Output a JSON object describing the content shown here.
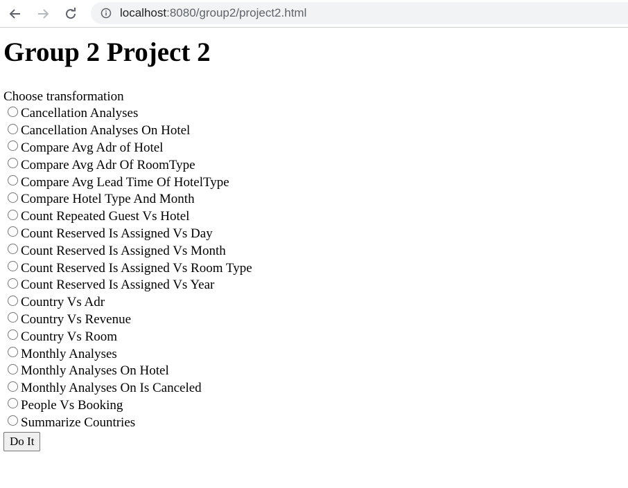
{
  "browser": {
    "url_host": "localhost",
    "url_rest": ":8080/group2/project2.html"
  },
  "page": {
    "title": "Group 2 Project 2",
    "form_label": "Choose transformation",
    "options": [
      "Cancellation Analyses",
      "Cancellation Analyses On Hotel",
      "Compare Avg Adr of Hotel",
      "Compare Avg Adr Of RoomType",
      "Compare Avg Lead Time Of HotelType",
      "Compare Hotel Type And Month",
      "Count Repeated Guest Vs Hotel",
      "Count Reserved Is Assigned Vs Day",
      "Count Reserved Is Assigned Vs Month",
      "Count Reserved Is Assigned Vs Room Type",
      "Count Reserved Is Assigned Vs Year",
      "Country Vs Adr",
      "Country Vs Revenue",
      "Country Vs Room",
      "Monthly Analyses",
      "Monthly Analyses On Hotel",
      "Monthly Analyses On Is Canceled",
      "People Vs Booking",
      "Summarize Countries"
    ],
    "submit_label": "Do It"
  }
}
